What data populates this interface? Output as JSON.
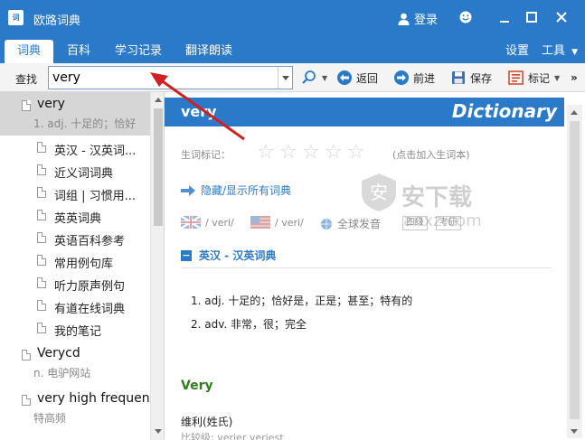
{
  "window": {
    "app_icon_text": "词",
    "title": "欧路词典",
    "login_label": "登录",
    "controls": [
      "smiley",
      "minimize",
      "maximize",
      "close"
    ]
  },
  "menu": {
    "tabs": [
      {
        "label": "词典",
        "active": true
      },
      {
        "label": "百科",
        "active": false
      },
      {
        "label": "学习记录",
        "active": false
      },
      {
        "label": "翻译朗读",
        "active": false
      }
    ],
    "settings_label": "设置",
    "tools_label": "工具"
  },
  "toolbar": {
    "find_label": "查找",
    "search_value": "very",
    "back_label": "返回",
    "forward_label": "前进",
    "save_label": "保存",
    "mark_label": "标记"
  },
  "word_list": [
    {
      "word": "very",
      "sub": "1. adj. 十足的；恰好",
      "selected": true
    },
    {
      "word": "Verycd",
      "sub": "n. 电驴网站",
      "selected": false
    },
    {
      "word": "very high frequen",
      "sub": "特高频",
      "selected": false
    }
  ],
  "dictionaries": [
    "英汉 - 汉英词...",
    "近义词词典",
    "词组 | 习惯用...",
    "英英词典",
    "英语百科参考",
    "常用例句库",
    "听力原声例句",
    "有道在线词典",
    "我的笔记"
  ],
  "content": {
    "header_word": "very",
    "header_brand": "Dictionary",
    "rating_label": "生词标记：",
    "rating_stars": 0,
    "rating_total": 5,
    "add_hint": "(点击加入生词本)",
    "toggle_all": "隐藏/显示所有词典",
    "phonetic_uk": "/ veri/",
    "phonetic_us": "/ veri/",
    "global_pron": "全球发音",
    "tags": [
      "四级",
      "考研"
    ],
    "section_title": "英汉 - 汉英词典",
    "definitions": [
      "1.  adj. 十足的；恰好是，正是；甚至；特有的",
      "2.  adv. 非常，很；完全"
    ],
    "entry2_title": "Very",
    "entry2_sub": "维利(姓氏)",
    "entry2_forms": "比较级: verier  veriest"
  },
  "colors": {
    "brand_blue": "#2b79c9",
    "entry_green": "#2e7d1f",
    "selected_bg": "#d6d6d6",
    "annotation_red": "#d21f1f"
  },
  "watermark": {
    "text": "安下载",
    "sub": "anxz.com"
  }
}
